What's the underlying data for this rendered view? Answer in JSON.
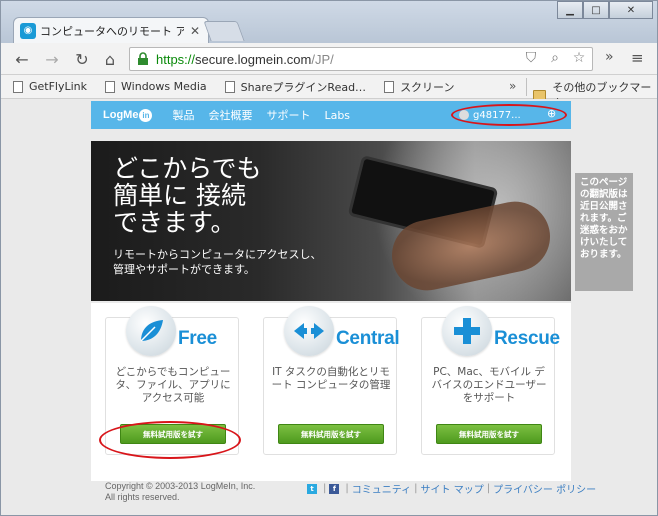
{
  "browser": {
    "tab_title": "コンピュータへのリモート アクセ",
    "url_scheme": "https://",
    "url_host": "secure.logmein.com",
    "url_path": "/JP/",
    "bookmarks": [
      {
        "label": "GetFlyLink"
      },
      {
        "label": "Windows Media"
      },
      {
        "label": "ShareプラグインRead…"
      },
      {
        "label": "スクリーン"
      }
    ],
    "bookmarks_more": "»",
    "other_bookmarks": "その他のブックマーク",
    "extensions_more": "»"
  },
  "site": {
    "logo_text": "LogMe",
    "logo_in": "in",
    "nav": [
      "製品",
      "会社概要",
      "サポート",
      "Labs"
    ],
    "account": "g48177..."
  },
  "hero": {
    "headline": [
      "どこからでも",
      "簡単に 接続",
      "できます。"
    ],
    "sub": [
      "リモートからコンピュータにアクセスし、",
      "管理やサポートができます。"
    ]
  },
  "notice": "このページの翻訳版は近日公開されます。ご迷惑をおかけいたしております。",
  "products": [
    {
      "name": "Free",
      "desc": "どこからでもコンピュータ、ファイル、アプリにアクセス可能",
      "button": "無料試用版を試す"
    },
    {
      "name": "Central",
      "desc": "IT タスクの自動化とリモート コンピュータの管理",
      "button": "無料試用版を試す"
    },
    {
      "name": "Rescue",
      "desc": "PC、Mac、モバイル デバイスのエンドユーザーをサポート",
      "button": "無料試用版を試す"
    }
  ],
  "footer": {
    "copyright": "Copyright © 2003-2013 LogMeIn, Inc.",
    "rights": "All rights reserved.",
    "links": [
      "コミュニティ",
      "サイト マップ",
      "プライバシー ポリシー"
    ]
  },
  "colors": {
    "accent": "#57b6e9",
    "product_name": "#1a8fd6",
    "trial_button": "#5ea82a",
    "highlight_oval": "#d8151a"
  }
}
